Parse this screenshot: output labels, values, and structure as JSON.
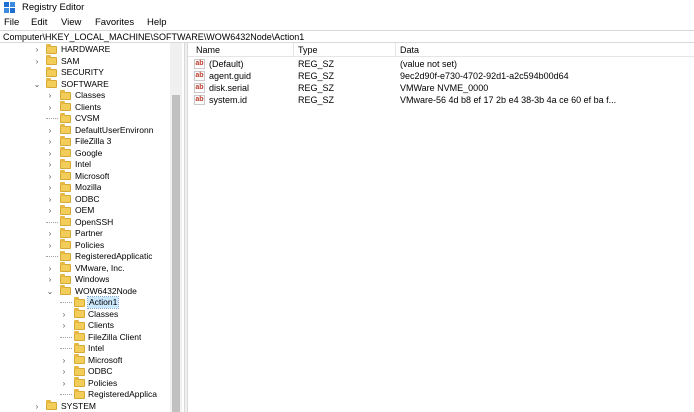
{
  "window": {
    "title": "Registry Editor",
    "icon": "registry-editor-icon"
  },
  "menu": [
    "File",
    "Edit",
    "View",
    "Favorites",
    "Help"
  ],
  "address": "Computer\\HKEY_LOCAL_MACHINE\\SOFTWARE\\WOW6432Node\\Action1",
  "tree": [
    {
      "label": "HARDWARE",
      "level": 1,
      "expander": "›"
    },
    {
      "label": "SAM",
      "level": 1,
      "expander": "›"
    },
    {
      "label": "SECURITY",
      "level": 1,
      "expander": ""
    },
    {
      "label": "SOFTWARE",
      "level": 1,
      "expander": "⌄"
    },
    {
      "label": "Classes",
      "level": 2,
      "expander": "›"
    },
    {
      "label": "Clients",
      "level": 2,
      "expander": "›"
    },
    {
      "label": "CVSM",
      "level": 2,
      "expander": ""
    },
    {
      "label": "DefaultUserEnvironn",
      "level": 2,
      "expander": "›"
    },
    {
      "label": "FileZilla 3",
      "level": 2,
      "expander": "›"
    },
    {
      "label": "Google",
      "level": 2,
      "expander": "›"
    },
    {
      "label": "Intel",
      "level": 2,
      "expander": "›"
    },
    {
      "label": "Microsoft",
      "level": 2,
      "expander": "›"
    },
    {
      "label": "Mozilla",
      "level": 2,
      "expander": "›"
    },
    {
      "label": "ODBC",
      "level": 2,
      "expander": "›"
    },
    {
      "label": "OEM",
      "level": 2,
      "expander": "›"
    },
    {
      "label": "OpenSSH",
      "level": 2,
      "expander": ""
    },
    {
      "label": "Partner",
      "level": 2,
      "expander": "›"
    },
    {
      "label": "Policies",
      "level": 2,
      "expander": "›"
    },
    {
      "label": "RegisteredApplicatic",
      "level": 2,
      "expander": ""
    },
    {
      "label": "VMware, Inc.",
      "level": 2,
      "expander": "›"
    },
    {
      "label": "Windows",
      "level": 2,
      "expander": "›"
    },
    {
      "label": "WOW6432Node",
      "level": 2,
      "expander": "⌄"
    },
    {
      "label": "Action1",
      "level": 3,
      "expander": "",
      "selected": true
    },
    {
      "label": "Classes",
      "level": 3,
      "expander": "›"
    },
    {
      "label": "Clients",
      "level": 3,
      "expander": "›"
    },
    {
      "label": "FileZilla Client",
      "level": 3,
      "expander": ""
    },
    {
      "label": "Intel",
      "level": 3,
      "expander": ""
    },
    {
      "label": "Microsoft",
      "level": 3,
      "expander": "›"
    },
    {
      "label": "ODBC",
      "level": 3,
      "expander": "›"
    },
    {
      "label": "Policies",
      "level": 3,
      "expander": "›"
    },
    {
      "label": "RegisteredApplica",
      "level": 3,
      "expander": ""
    },
    {
      "label": "SYSTEM",
      "level": 1,
      "expander": "›"
    }
  ],
  "columns": {
    "name": "Name",
    "type": "Type",
    "data": "Data"
  },
  "values": [
    {
      "name": "(Default)",
      "type": "REG_SZ",
      "data": "(value not set)"
    },
    {
      "name": "agent.guid",
      "type": "REG_SZ",
      "data": "9ec2d90f-e730-4702-92d1-a2c594b00d64"
    },
    {
      "name": "disk.serial",
      "type": "REG_SZ",
      "data": "VMWare NVME_0000"
    },
    {
      "name": "system.id",
      "type": "REG_SZ",
      "data": "VMware-56 4d b8 ef 17 2b e4 38-3b 4a ce 60 ef ba f..."
    }
  ],
  "value_icon_text": "ab",
  "colors": {
    "folder": "#f3cd5a",
    "selection": "#cce8ff",
    "string_icon": "#c0392b"
  }
}
